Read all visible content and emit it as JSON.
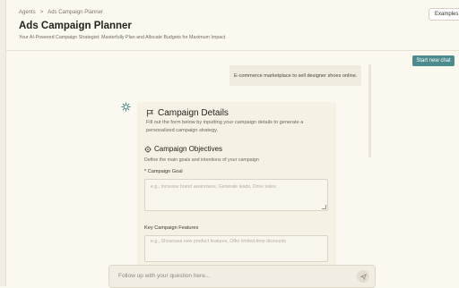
{
  "breadcrumb": {
    "root": "Agents",
    "separator": ">",
    "current": "Ads Campaign Planner"
  },
  "header": {
    "title": "Ads Campaign Planner",
    "subtitle": "Your AI-Powered Campaign Strategist: Masterfully Plan and Allocate Budgets for Maximum Impact",
    "examples_label": "Examples"
  },
  "actions": {
    "start_chat_label": "Start new chat"
  },
  "chat": {
    "user_message": "E-commerce marketplace to sell designer shoes online.",
    "card": {
      "title": "Campaign Details",
      "description": "Fill out the form below by inputting your campaign details to generate a personalized campaign strategy.",
      "objectives_title": "Campaign Objectives",
      "objectives_desc": "Define the main goals and intentions of your campaign",
      "goal_label": "* Campaign Goal",
      "goal_placeholder": "e.g., Increase brand awareness, Generate leads, Drive sales",
      "features_label": "Key Campaign Features",
      "features_placeholder": "e.g., Showcase new product features, Offer limited-time discounts"
    }
  },
  "followup": {
    "placeholder": "Follow up with your question here..."
  },
  "colors": {
    "accent": "#4d8b8f",
    "background": "#fbf8ef",
    "card": "#f5f1e4"
  },
  "icons": {
    "assistant": "sparkle-icon",
    "card": "flag-icon",
    "objectives": "target-icon",
    "send": "send-icon"
  }
}
